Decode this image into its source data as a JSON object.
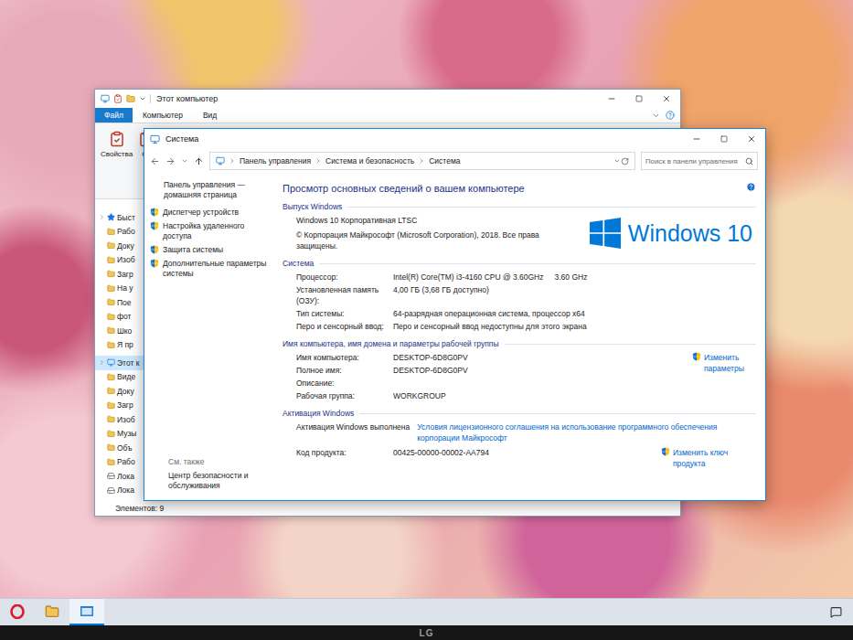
{
  "explorer": {
    "title": "Этот компьютер",
    "tabs": [
      {
        "label": "Файл",
        "selected": true
      },
      {
        "label": "Компьютер",
        "selected": false
      },
      {
        "label": "Вид",
        "selected": false
      }
    ],
    "ribbon_buttons": [
      "Свойства",
      "От"
    ],
    "nav_items": [
      {
        "label": "Быст",
        "kind": "pin-root",
        "selected": false
      },
      {
        "label": "Рабо",
        "kind": "folder",
        "selected": false
      },
      {
        "label": "Доку",
        "kind": "folder",
        "selected": false
      },
      {
        "label": "Изоб",
        "kind": "folder",
        "selected": false
      },
      {
        "label": "Загр",
        "kind": "folder",
        "selected": false
      },
      {
        "label": "На у",
        "kind": "folder",
        "selected": false
      },
      {
        "label": "Пое",
        "kind": "folder",
        "selected": false
      },
      {
        "label": "фот",
        "kind": "folder",
        "selected": false
      },
      {
        "label": "Шко",
        "kind": "folder",
        "selected": false
      },
      {
        "label": "Я пр",
        "kind": "folder",
        "selected": false
      },
      {
        "label": "Этот к",
        "kind": "pc-root",
        "selected": true
      },
      {
        "label": "Виде",
        "kind": "folder",
        "selected": false
      },
      {
        "label": "Доку",
        "kind": "folder",
        "selected": false
      },
      {
        "label": "Загр",
        "kind": "folder",
        "selected": false
      },
      {
        "label": "Изоб",
        "kind": "folder",
        "selected": false
      },
      {
        "label": "Музы",
        "kind": "folder",
        "selected": false
      },
      {
        "label": "Объ",
        "kind": "folder",
        "selected": false
      },
      {
        "label": "Рабо",
        "kind": "folder",
        "selected": false
      },
      {
        "label": "Лока",
        "kind": "drive",
        "selected": false
      },
      {
        "label": "Лока",
        "kind": "drive",
        "selected": false
      }
    ],
    "status_bar": "Элементов: 9"
  },
  "system": {
    "title": "Система",
    "breadcrumb": [
      "Панель управления",
      "Система и безопасность",
      "Система"
    ],
    "search": {
      "placeholder": "Поиск в панели управления"
    },
    "sidebar": {
      "home": "Панель управления — домашняя страница",
      "links": [
        "Диспетчер устройств",
        "Настройка удаленного доступа",
        "Защита системы",
        "Дополнительные параметры системы"
      ],
      "see_also": {
        "title": "См. также",
        "links": [
          "Центр безопасности и обслуживания"
        ]
      }
    },
    "heading": "Просмотр основных сведений о вашем компьютере",
    "edition": {
      "title": "Выпуск Windows",
      "lines": [
        "Windows 10 Корпоративная LTSC",
        "© Корпорация Майкрософт (Microsoft Corporation), 2018. Все права защищены."
      ],
      "logo": "Windows 10"
    },
    "specs": {
      "title": "Система",
      "rows": [
        {
          "label": "Процессор:",
          "value": "Intel(R) Core(TM) i3-4160 CPU @ 3.60GHz",
          "extra": "3.60 GHz"
        },
        {
          "label": "Установленная память (ОЗУ):",
          "value": "4,00 ГБ (3,68 ГБ доступно)"
        },
        {
          "label": "Тип системы:",
          "value": "64-разрядная операционная система, процессор x64"
        },
        {
          "label": "Перо и сенсорный ввод:",
          "value": "Перо и сенсорный ввод недоступны для этого экрана"
        }
      ]
    },
    "computer_name": {
      "title": "Имя компьютера, имя домена и параметры рабочей группы",
      "rows": [
        {
          "label": "Имя компьютера:",
          "value": "DESKTOP-6D8G0PV"
        },
        {
          "label": "Полное имя:",
          "value": "DESKTOP-6D8G0PV"
        },
        {
          "label": "Описание:",
          "value": ""
        },
        {
          "label": "Рабочая группа:",
          "value": "WORKGROUP"
        }
      ],
      "link": "Изменить параметры"
    },
    "activation": {
      "title": "Активация Windows",
      "status": "Активация Windows выполнена",
      "license_link": "Условия лицензионного соглашения на использование программного обеспечения корпорации Майкрософт",
      "rows": [
        {
          "label": "Код продукта:",
          "value": "00425-00000-00002-AA794"
        }
      ],
      "link": "Изменить ключ продукта"
    }
  },
  "taskbar": {
    "apps": [
      {
        "kind": "opera",
        "active": false
      },
      {
        "kind": "explorer",
        "active": false
      },
      {
        "kind": "system",
        "active": true
      }
    ]
  },
  "monitor": {
    "brand": "LG"
  }
}
